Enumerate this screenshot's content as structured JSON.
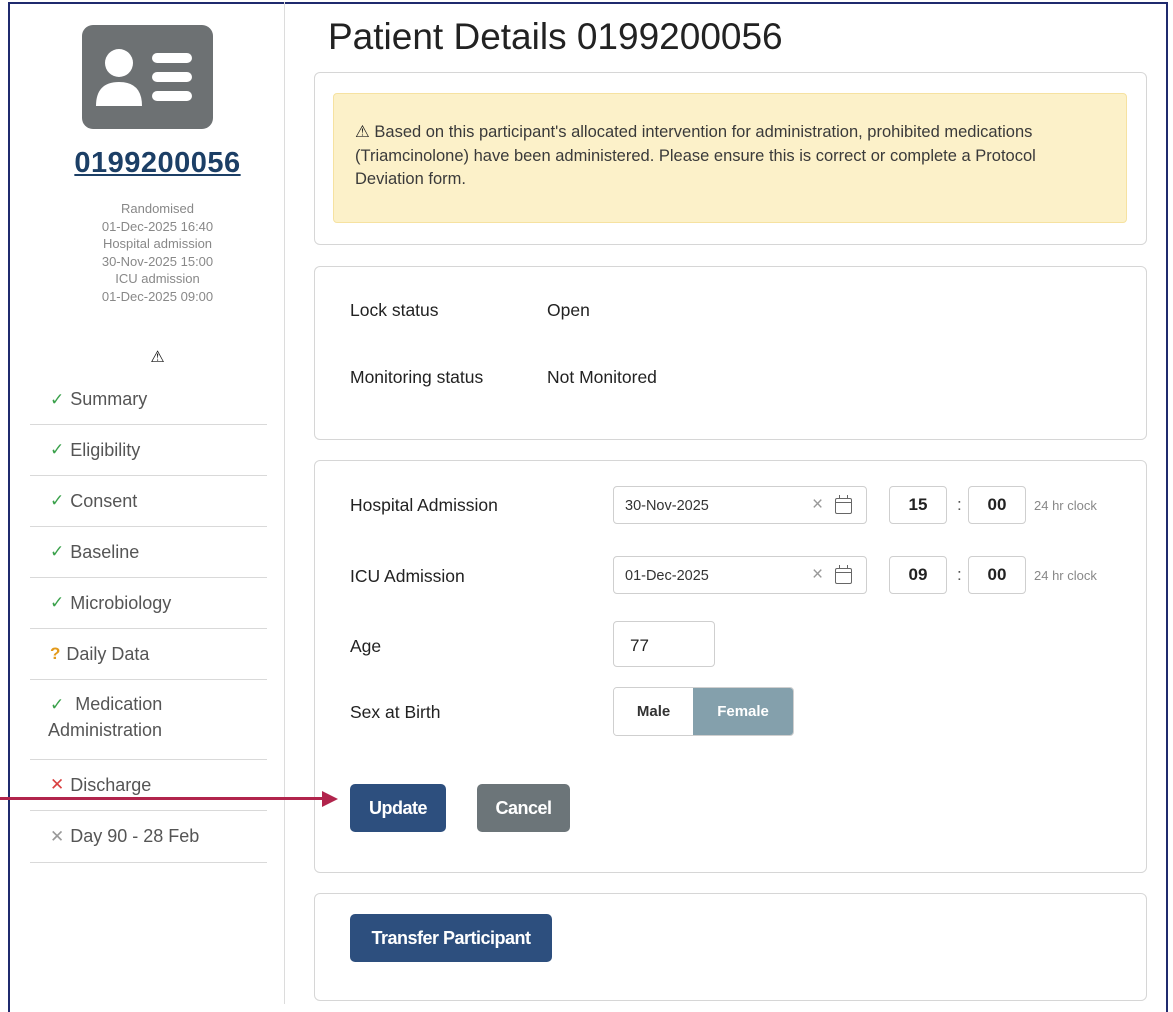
{
  "sidebar": {
    "participant_id": "0199200056",
    "meta": [
      "Randomised",
      "01-Dec-2025 16:40",
      "Hospital admission",
      "30-Nov-2025 15:00",
      "ICU admission",
      "01-Dec-2025 09:00"
    ],
    "warning_glyph": "⚠",
    "nav": [
      {
        "mark": "✓",
        "status": "done",
        "label": "Summary"
      },
      {
        "mark": "✓",
        "status": "done",
        "label": "Eligibility"
      },
      {
        "mark": "✓",
        "status": "done",
        "label": "Consent"
      },
      {
        "mark": "✓",
        "status": "done",
        "label": "Baseline"
      },
      {
        "mark": "✓",
        "status": "done",
        "label": "Microbiology"
      },
      {
        "mark": "?",
        "status": "pending",
        "label": "Daily Data"
      },
      {
        "mark": "✓",
        "status": "done",
        "label": "Medication",
        "label2": "Administration"
      },
      {
        "mark": "✕",
        "status": "no",
        "label": "Discharge"
      },
      {
        "mark": "✕",
        "status": "gray",
        "label": "Day 90 - 28 Feb"
      }
    ]
  },
  "page_title": "Patient Details 0199200056",
  "alert": {
    "icon": "⚠",
    "text": "Based on this participant's allocated intervention for administration, prohibited medications (Triamcinolone) have been administered. Please ensure this is correct or complete a Protocol Deviation form."
  },
  "status": {
    "lock_label": "Lock status",
    "lock_value": "Open",
    "monitoring_label": "Monitoring status",
    "monitoring_value": "Not Monitored"
  },
  "form": {
    "hospital_label": "Hospital Admission",
    "hospital_date": "30-Nov-2025",
    "hospital_hour": "15",
    "hospital_minute": "00",
    "icu_label": "ICU Admission",
    "icu_date": "01-Dec-2025",
    "icu_hour": "09",
    "icu_minute": "00",
    "clock_hint": "24 hr clock",
    "time_separator": ":",
    "clear_glyph": "×",
    "age_label": "Age",
    "age_value": "77",
    "sex_label": "Sex at Birth",
    "sex_options": [
      "Male",
      "Female"
    ],
    "sex_selected": "Female",
    "update_label": "Update",
    "cancel_label": "Cancel"
  },
  "transfer": {
    "button_label": "Transfer Participant"
  },
  "colors": {
    "primary": "#2d4f7e",
    "secondary": "#6c7579",
    "alert_bg": "#fcf1c9",
    "selected_toggle": "#84a0ac",
    "annotation_arrow": "#b1244c",
    "done": "#3aa14b",
    "pending": "#e39a1b",
    "no": "#d94040"
  }
}
